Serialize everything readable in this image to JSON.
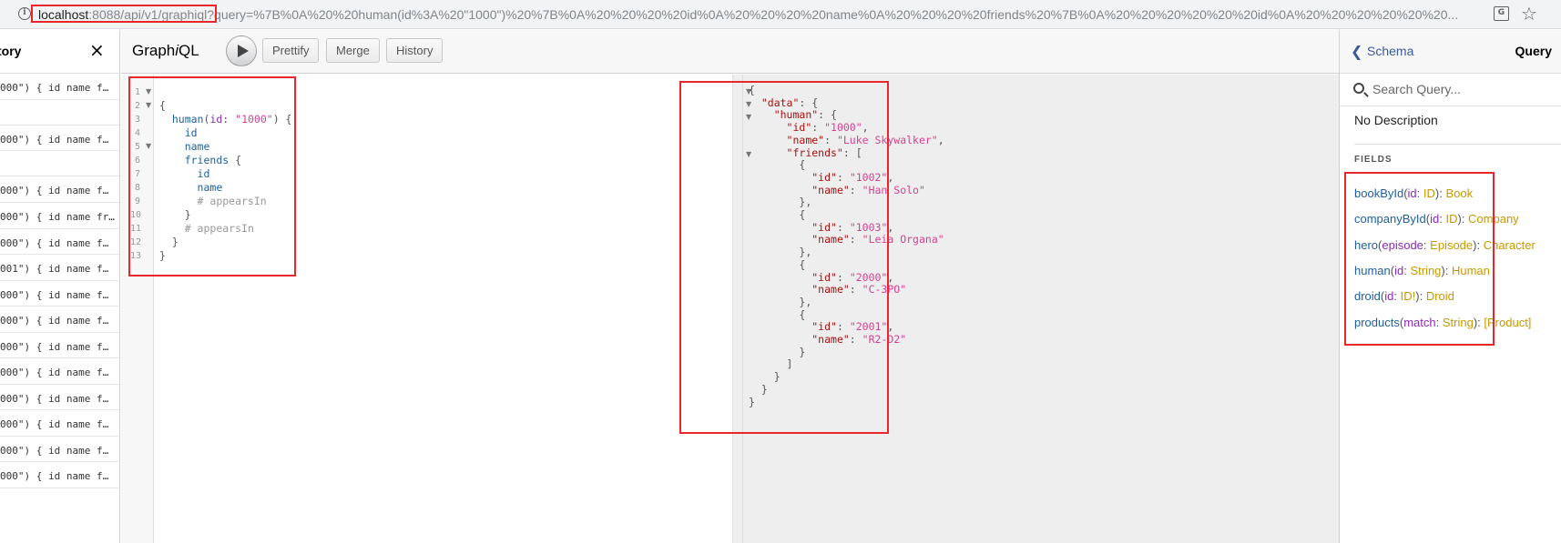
{
  "browser": {
    "url_host": "localhost",
    "url_rest": ":8088/api/v1/graphiql?query=%7B%0A%20%20human(id%3A%20\"1000\")%20%7B%0A%20%20%20%20id%0A%20%20%20%20name%0A%20%20%20%20friends%20%7B%0A%20%20%20%20%20%20id%0A%20%20%20%20%20%20..."
  },
  "history": {
    "title": "tory",
    "close_label": "×",
    "items": [
      "000\") { id name f…",
      "",
      "000\") { id name f…",
      "",
      "000\") { id name f…",
      "000\") { id name fr…",
      "000\") { id name f…",
      "001\") { id name f…",
      "000\") { id name f…",
      "000\") { id name f…",
      "000\") { id name f…",
      "000\") { id name f…",
      "000\") { id name f…",
      "000\") { id name f…",
      "000\") { id name f…",
      "000\") { id name f…"
    ]
  },
  "toolbar": {
    "logo_pre": "Graph",
    "logo_i": "i",
    "logo_post": "QL",
    "prettify": "Prettify",
    "merge": "Merge",
    "history": "History"
  },
  "query_lines": [
    "1",
    "2",
    "3",
    "4",
    "5",
    "6",
    "7",
    "8",
    "9",
    "10",
    "11",
    "12",
    "13"
  ],
  "query": {
    "l1": "{",
    "human": "human",
    "lparen": "(",
    "arg": "id",
    "colon": ": ",
    "argval": "\"1000\"",
    "rparen_brace": ") {",
    "id": "id",
    "name": "name",
    "friends": "friends",
    "brace_open": " {",
    "id2": "id",
    "name2": "name",
    "comment1": "# appearsIn",
    "close_inner": "}",
    "comment2": "# appearsIn",
    "close_mid": "}",
    "close_outer": "}"
  },
  "result": {
    "open": "{",
    "data_key": "\"data\"",
    "human_key": "\"human\"",
    "id_key": "\"id\"",
    "id_val": "\"1000\"",
    "name_key": "\"name\"",
    "name_val": "\"Luke Skywalker\"",
    "friends_key": "\"friends\"",
    "friends": [
      {
        "id": "\"1002\"",
        "name": "\"Han Solo\""
      },
      {
        "id": "\"1003\"",
        "name": "\"Leia Organa\""
      },
      {
        "id": "\"2000\"",
        "name": "\"C-3PO\""
      },
      {
        "id": "\"2001\"",
        "name": "\"R2-D2\""
      }
    ]
  },
  "docs": {
    "back_label": "Schema",
    "title": "Query",
    "search_placeholder": "Search Query...",
    "no_description": "No Description",
    "fields_title": "FIELDS",
    "fields": [
      {
        "name": "bookById",
        "args": [
          {
            "n": "id",
            "t": "ID"
          }
        ],
        "type": "Book"
      },
      {
        "name": "companyById",
        "args": [
          {
            "n": "id",
            "t": "ID"
          }
        ],
        "type": "Company"
      },
      {
        "name": "hero",
        "args": [
          {
            "n": "episode",
            "t": "Episode"
          }
        ],
        "type": "Character"
      },
      {
        "name": "human",
        "args": [
          {
            "n": "id",
            "t": "String"
          }
        ],
        "type": "Human"
      },
      {
        "name": "droid",
        "args": [
          {
            "n": "id",
            "t": "ID!"
          }
        ],
        "type": "Droid"
      },
      {
        "name": "products",
        "args": [
          {
            "n": "match",
            "t": "String"
          }
        ],
        "type": "[Product]"
      }
    ]
  },
  "colors": {
    "highlight": "#e8262b",
    "field": "#1f61a0",
    "argument": "#8b2bb9",
    "string": "#d64292",
    "type": "#ca9800"
  }
}
